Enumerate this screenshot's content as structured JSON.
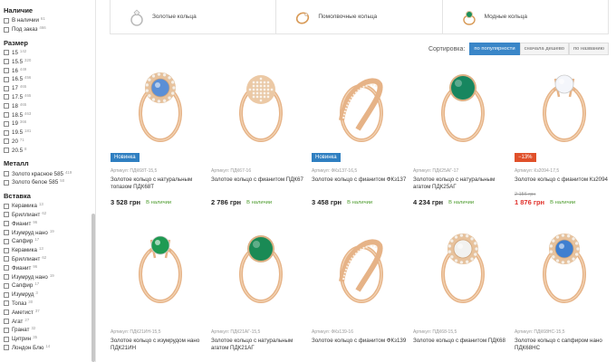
{
  "sidebar": {
    "groups": [
      {
        "title": "Наличие",
        "items": [
          {
            "label": "В наличии",
            "count": "61"
          },
          {
            "label": "Под заказ",
            "count": "466"
          }
        ]
      },
      {
        "title": "Размер",
        "items": [
          {
            "label": "15",
            "count": "142"
          },
          {
            "label": "15.5",
            "count": "320"
          },
          {
            "label": "16",
            "count": "449"
          },
          {
            "label": "16.5",
            "count": "456"
          },
          {
            "label": "17",
            "count": "465"
          },
          {
            "label": "17.5",
            "count": "465"
          },
          {
            "label": "18",
            "count": "465"
          },
          {
            "label": "18.5",
            "count": "463"
          },
          {
            "label": "19",
            "count": "366"
          },
          {
            "label": "19.5",
            "count": "181"
          },
          {
            "label": "20",
            "count": "71"
          },
          {
            "label": "20.5",
            "count": "8"
          }
        ]
      },
      {
        "title": "Металл",
        "items": [
          {
            "label": "Золото красное 585",
            "count": "419"
          },
          {
            "label": "Золото белое 585",
            "count": "50"
          }
        ]
      },
      {
        "title": "Вставка",
        "items": [
          {
            "label": "Керамика",
            "count": "13"
          },
          {
            "label": "Бриллиант",
            "count": "62"
          },
          {
            "label": "Фианит",
            "count": "96"
          },
          {
            "label": "Изумруд нано",
            "count": "19"
          },
          {
            "label": "Сапфир",
            "count": "17"
          },
          {
            "label": "Керамика",
            "count": "13"
          },
          {
            "label": "Бриллиант",
            "count": "62"
          },
          {
            "label": "Фианит",
            "count": "96"
          },
          {
            "label": "Изумруд нано",
            "count": "19"
          },
          {
            "label": "Сапфир",
            "count": "17"
          },
          {
            "label": "Изумруд",
            "count": "3"
          },
          {
            "label": "Топаз",
            "count": "30"
          },
          {
            "label": "Аметист",
            "count": "37"
          },
          {
            "label": "Агат",
            "count": "27"
          },
          {
            "label": "Гранат",
            "count": "32"
          },
          {
            "label": "Цитрин",
            "count": "35"
          },
          {
            "label": "Лондон Блю",
            "count": "14"
          }
        ]
      }
    ]
  },
  "categories": [
    {
      "label": "Золотые кольца",
      "icon": "silver-ring-icon"
    },
    {
      "label": "Помолвочные кольца",
      "icon": "engagement-ring-icon"
    },
    {
      "label": "Модные кольца",
      "icon": "emerald-ring-icon"
    }
  ],
  "sort": {
    "label": "Сортировка:",
    "options": [
      "по популярности",
      "сначала дешево",
      "по названию"
    ],
    "active": 0
  },
  "products": [
    {
      "badge": "Новинка",
      "badge_type": "new",
      "article": "Артикул: ПДК68Т-15,5",
      "name": "Золотое кольцо с натуральным топазом ПДК68Т",
      "price": "3 528 грн",
      "old_price": "",
      "stock": "В наличии",
      "stone": "#5b8fd6",
      "style": "halo"
    },
    {
      "badge": "",
      "badge_type": "",
      "article": "Артикул: ПДК67-16",
      "name": "Золотое кольцо с фианитом ПДК67",
      "price": "2 786 грн",
      "old_price": "",
      "stock": "В наличии",
      "stone": "#f1e4d4",
      "style": "pave"
    },
    {
      "badge": "Новинка",
      "badge_type": "new",
      "article": "Артикул: ФКз137-16,5",
      "name": "Золотое кольцо с фианитом ФКз137",
      "price": "3 458 грн",
      "old_price": "",
      "stock": "В наличии",
      "stone": "",
      "style": "twist"
    },
    {
      "badge": "",
      "badge_type": "",
      "article": "Артикул: ПДК25АГ-17",
      "name": "Золотое кольцо с натуральным агатом ПДК25АГ",
      "price": "4 234 грн",
      "old_price": "",
      "stock": "В наличии",
      "stone": "#17865f",
      "style": "solitaire"
    },
    {
      "badge": "−13%",
      "badge_type": "sale",
      "article": "Артикул: Кз2094-17,5",
      "name": "Золотое кольцо с фианитом Кз2094",
      "price": "1 876 грн",
      "old_price": "2 156 грн",
      "stock": "В наличии",
      "stone": "#f4f6fb",
      "style": "crown"
    },
    {
      "badge": "",
      "badge_type": "",
      "article": "Артикул: ПДК21ИН-15,5",
      "name": "Золотое кольцо с изумрудом нано ПДК21ИН",
      "price": "",
      "old_price": "",
      "stock": "",
      "stone": "#1f9a52",
      "style": "crown"
    },
    {
      "badge": "",
      "badge_type": "",
      "article": "Артикул: ПДК21АГ-15,5",
      "name": "Золотое кольцо с натуральным агатом ПДК21АГ",
      "price": "",
      "old_price": "",
      "stock": "",
      "stone": "#1a8a55",
      "style": "solitaire"
    },
    {
      "badge": "",
      "badge_type": "",
      "article": "Артикул: ФКз139-16",
      "name": "Золотое кольцо с фианитом ФКз139",
      "price": "",
      "old_price": "",
      "stock": "",
      "stone": "",
      "style": "twist"
    },
    {
      "badge": "",
      "badge_type": "",
      "article": "Артикул: ПДК68-15,5",
      "name": "Золотое кольцо с фианитом ПДК68",
      "price": "",
      "old_price": "",
      "stock": "",
      "stone": "#f2f2f0",
      "style": "halo"
    },
    {
      "badge": "",
      "badge_type": "",
      "article": "Артикул: ПДК68НС-15,5",
      "name": "Золотое кольцо с сапфиром нано ПДК68НС",
      "price": "",
      "old_price": "",
      "stock": "",
      "stone": "#3f7fd0",
      "style": "halo"
    }
  ],
  "colors": {
    "gold": "#e6b387",
    "accent": "#3a86c8",
    "badge_new": "#2f7fc1",
    "badge_sale": "#e0502a",
    "in_stock": "#4a9a2a",
    "sale_price": "#e0302a"
  }
}
